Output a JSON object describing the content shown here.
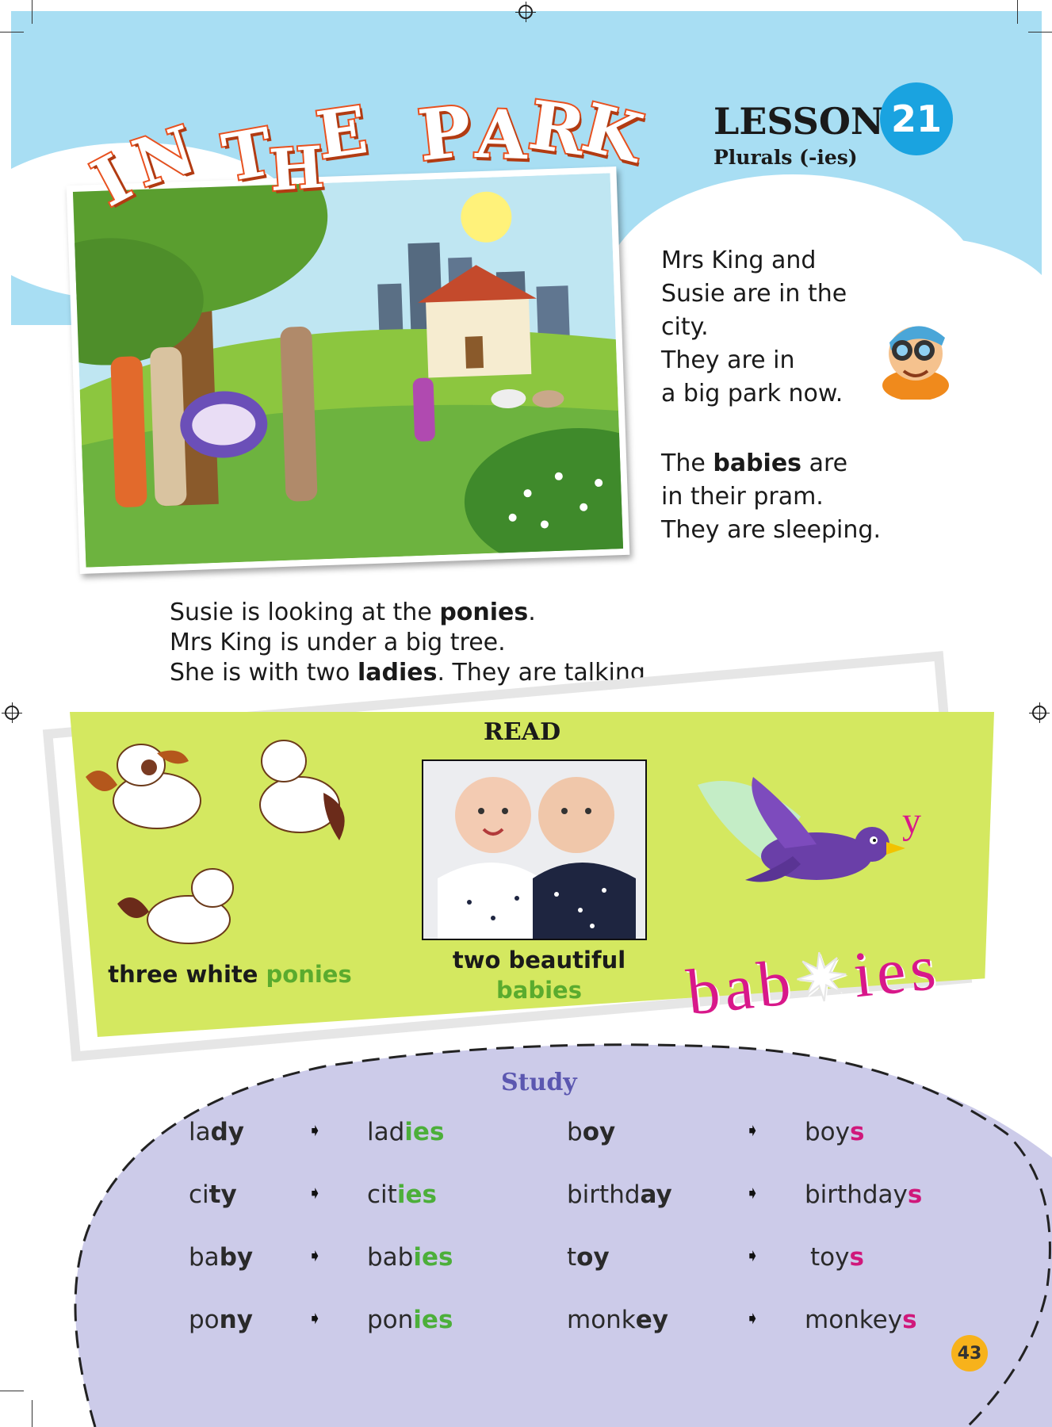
{
  "header": {
    "title_letters": [
      "I",
      "N",
      "T",
      "H",
      "E",
      "P",
      "A",
      "R",
      "K"
    ],
    "lesson_label": "LESSON",
    "lesson_number": "21",
    "subtitle": "Plurals (-ies)"
  },
  "story": {
    "para1": [
      "Mrs King and",
      "Susie are in the city.",
      "They are in",
      "a big park now."
    ],
    "para2_pre": "The ",
    "para2_bold": "babies",
    "para2_post": " are",
    "para2_rest": [
      "in their pram.",
      "They are sleeping."
    ],
    "para3_l1_pre": "Susie is looking at the ",
    "para3_l1_bold": "ponies",
    "para3_l1_post": ".",
    "para3_l2": "Mrs King is under a big tree.",
    "para3_l3_pre": "She is with two ",
    "para3_l3_bold": "ladies",
    "para3_l3_post": ". They are talking."
  },
  "read": {
    "heading": "READ",
    "caption1_black": "three white ",
    "caption1_green": "ponies",
    "caption2_black": "two beautiful",
    "caption2_green": "babies",
    "magic_word_left": "bab",
    "magic_word_right": "ies",
    "magic_letter": "y"
  },
  "study": {
    "heading": "Study",
    "left_pairs": [
      {
        "base_pre": "la",
        "base_bold": "dy",
        "plural_stem": "lad",
        "plural_suffix": "ies"
      },
      {
        "base_pre": "ci",
        "base_bold": "ty",
        "plural_stem": "cit",
        "plural_suffix": "ies"
      },
      {
        "base_pre": "ba",
        "base_bold": "by",
        "plural_stem": "bab",
        "plural_suffix": "ies"
      },
      {
        "base_pre": "po",
        "base_bold": "ny",
        "plural_stem": "pon",
        "plural_suffix": "ies"
      }
    ],
    "right_pairs": [
      {
        "base_pre": "b",
        "base_bold": "oy",
        "plural_stem": "boy",
        "plural_suffix": "s"
      },
      {
        "base_pre": "birthd",
        "base_bold": "ay",
        "plural_stem": "birthday",
        "plural_suffix": "s"
      },
      {
        "base_pre": "t",
        "base_bold": "oy",
        "plural_stem": "toy",
        "plural_suffix": "s"
      },
      {
        "base_pre": "monk",
        "base_bold": "ey",
        "plural_stem": "monkey",
        "plural_suffix": "s"
      }
    ]
  },
  "page_number": "43",
  "colors": {
    "sky": "#a8def3",
    "title_outline": "#e8511f",
    "lesson_badge": "#1aa3e0",
    "read_panel": "#d4e860",
    "study_blob": "#cccbe9",
    "green_suffix": "#4caf3a",
    "pink_suffix": "#d0187b",
    "page_badge": "#f7b21b"
  }
}
